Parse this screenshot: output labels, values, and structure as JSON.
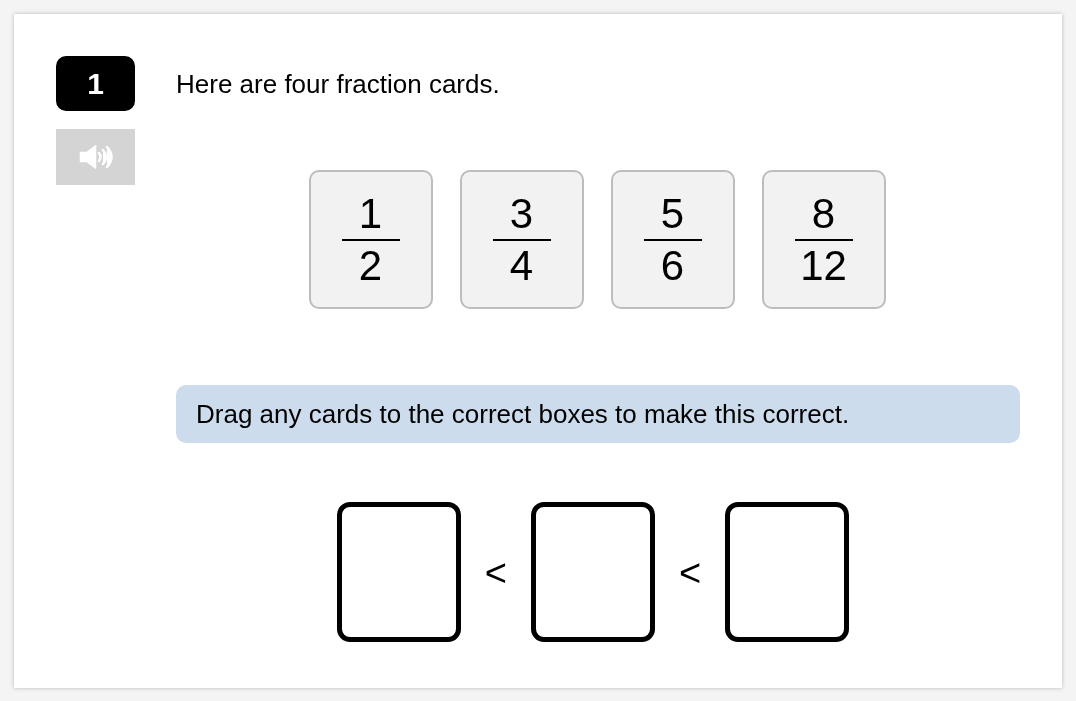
{
  "question": {
    "number": "1",
    "text": "Here are four fraction cards."
  },
  "cards": [
    {
      "numerator": "1",
      "denominator": "2"
    },
    {
      "numerator": "3",
      "denominator": "4"
    },
    {
      "numerator": "5",
      "denominator": "6"
    },
    {
      "numerator": "8",
      "denominator": "12"
    }
  ],
  "instruction": "Drag any cards to the correct boxes to make this correct.",
  "answer": [
    {
      "kind": "box"
    },
    {
      "kind": "comparator",
      "symbol": "<"
    },
    {
      "kind": "box"
    },
    {
      "kind": "comparator",
      "symbol": "<"
    },
    {
      "kind": "box"
    }
  ]
}
